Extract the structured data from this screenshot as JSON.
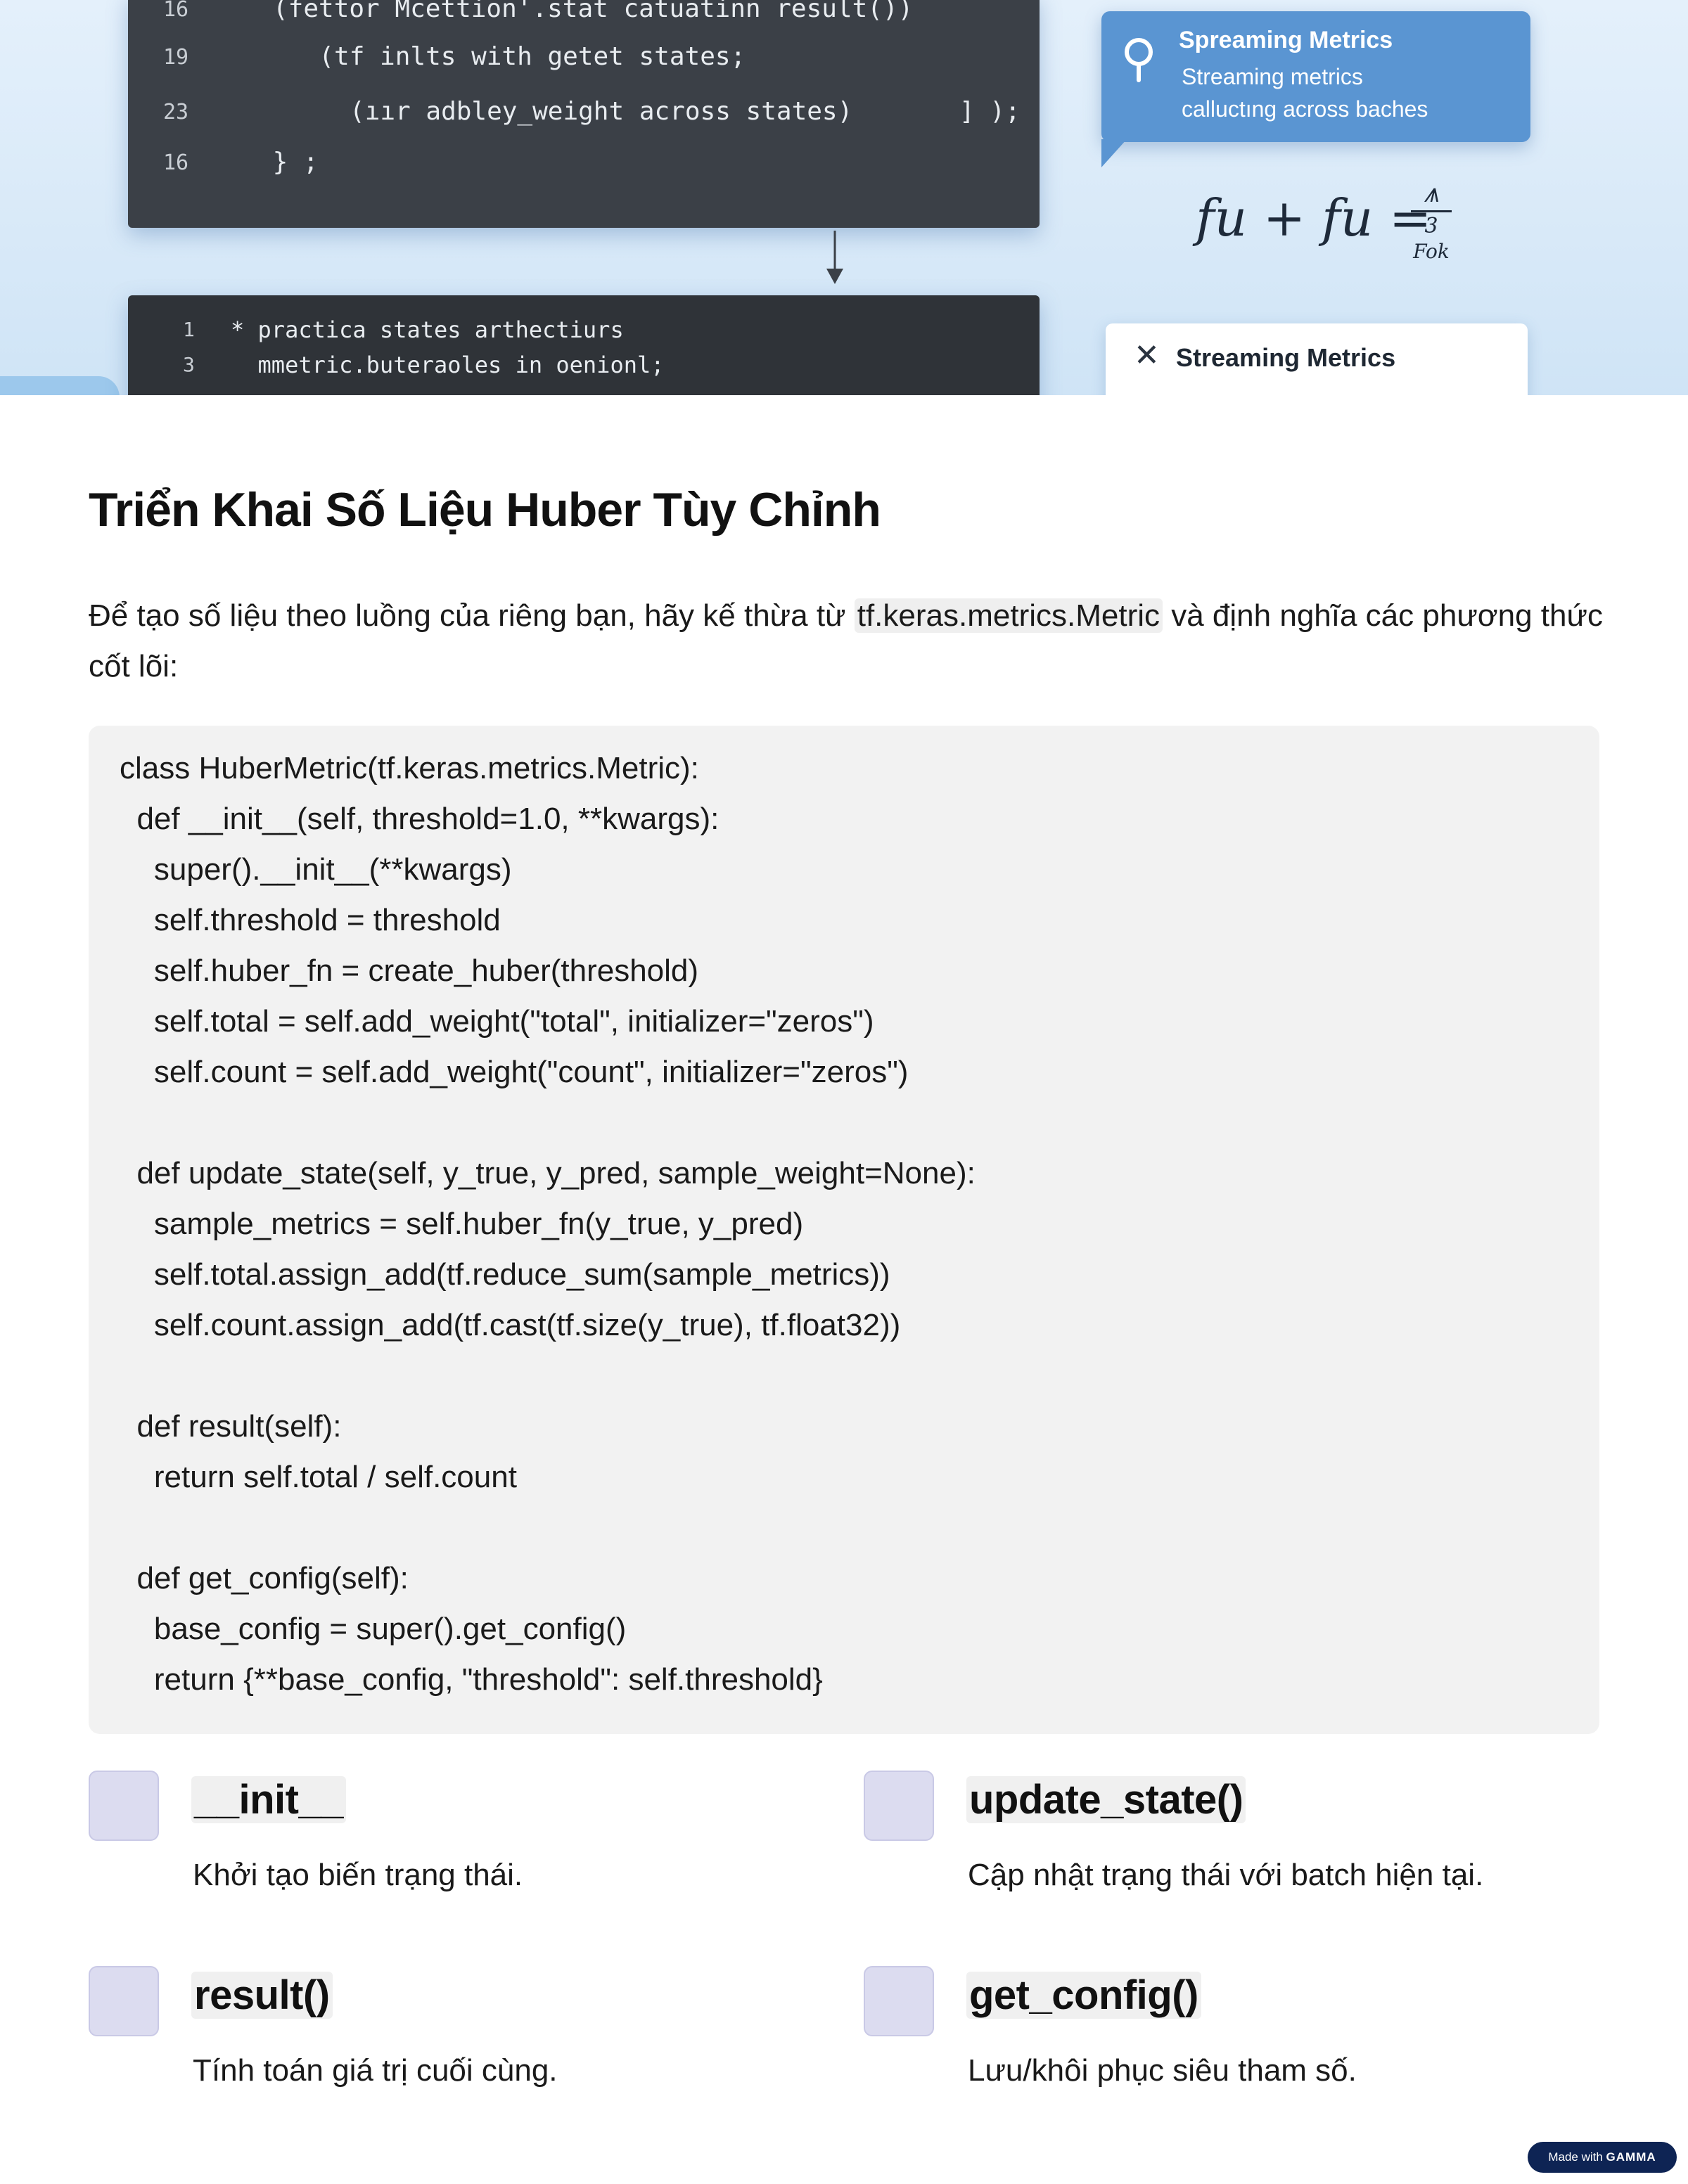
{
  "hero": {
    "code_top_lines": [
      {
        "num": "16",
        "text": "(fettor Mcettion'.stat catuatinn result())"
      },
      {
        "num": "19",
        "text": "  (tf inlts with getet states;"
      },
      {
        "num": "23",
        "text": "   (ıır adbley_weight across states)       ] );"
      },
      {
        "num": "16",
        "text": " } ;"
      }
    ],
    "code_bottom_lines": [
      {
        "num": "1",
        "text": "* practica states arthectiurs"
      },
      {
        "num": "3",
        "text": "  mmetric.buteraoles in oenionl;"
      }
    ],
    "metric_card": {
      "line1": "Spreaming Metrics",
      "line2": "Streaming metrics",
      "line3": "calluctıng across baches"
    },
    "formula": {
      "lhs": "fu + fu =",
      "num": "⩚",
      "den": "3",
      "sub": "Fok"
    },
    "stream_card": {
      "icon": "close-icon",
      "label": "Streaming Metrics"
    }
  },
  "article": {
    "title": "Triển Khai Số Liệu Huber Tùy Chỉnh",
    "intro_before": "Để tạo số liệu theo luồng của riêng bạn, hãy kế thừa từ ",
    "intro_code": "tf.keras.metrics.Metric",
    "intro_after": " và định nghĩa các phương thức cốt lõi:"
  },
  "code": {
    "lines": [
      "class HuberMetric(tf.keras.metrics.Metric):",
      "  def __init__(self, threshold=1.0, **kwargs):",
      "    super().__init__(**kwargs)",
      "    self.threshold = threshold",
      "    self.huber_fn = create_huber(threshold)",
      "    self.total = self.add_weight(\"total\", initializer=\"zeros\")",
      "    self.count = self.add_weight(\"count\", initializer=\"zeros\")",
      "",
      "  def update_state(self, y_true, y_pred, sample_weight=None):",
      "    sample_metrics = self.huber_fn(y_true, y_pred)",
      "    self.total.assign_add(tf.reduce_sum(sample_metrics))",
      "    self.count.assign_add(tf.cast(tf.size(y_true), tf.float32))",
      "",
      "  def result(self):",
      "    return self.total / self.count",
      "",
      "  def get_config(self):",
      "    base_config = super().get_config()",
      "    return {**base_config, \"threshold\": self.threshold}"
    ]
  },
  "methods": [
    {
      "name": "__init__",
      "desc": "Khởi tạo biến trạng thái."
    },
    {
      "name": "update_state()",
      "desc": "Cập nhật trạng thái với batch hiện tại."
    },
    {
      "name": "result()",
      "desc": "Tính toán giá trị cuối cùng."
    },
    {
      "name": "get_config()",
      "desc": "Lưu/khôi phục siêu tham số."
    }
  ],
  "footer": {
    "made_with": "Made with",
    "brand": "GAMMA"
  },
  "colors": {
    "code_bg": "#f2f2f2",
    "badge": "#dcdcf0",
    "hero_card": "#5a95d2",
    "gamma_badge": "#0e2454"
  }
}
